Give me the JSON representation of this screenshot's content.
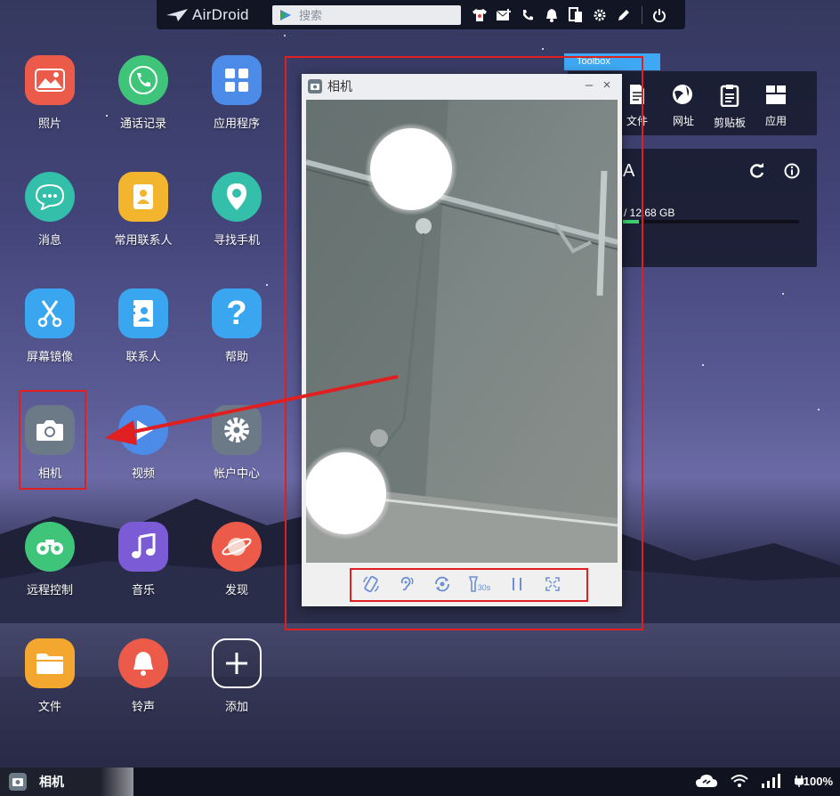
{
  "topbar": {
    "brand": "AirDroid",
    "search_placeholder": "搜索"
  },
  "apps": [
    {
      "label": "照片"
    },
    {
      "label": "通话记录"
    },
    {
      "label": "应用程序"
    },
    {
      "label": "消息"
    },
    {
      "label": "常用联系人"
    },
    {
      "label": "寻找手机"
    },
    {
      "label": "屏幕镜像"
    },
    {
      "label": "联系人"
    },
    {
      "label": "帮助"
    },
    {
      "label": "相机"
    },
    {
      "label": "视频"
    },
    {
      "label": "帐户中心"
    },
    {
      "label": "远程控制"
    },
    {
      "label": "音乐"
    },
    {
      "label": "发现"
    },
    {
      "label": "文件"
    },
    {
      "label": "铃声"
    },
    {
      "label": "添加"
    }
  ],
  "camera_window": {
    "title": "相机",
    "minimize": "–",
    "close": "×",
    "timer_label": "30s"
  },
  "toolbox": {
    "label": "Toolbox",
    "tools": [
      {
        "label": "文件"
      },
      {
        "label": "网址"
      },
      {
        "label": "剪贴板"
      },
      {
        "label": "应用"
      }
    ]
  },
  "device": {
    "name_partial": "A",
    "storage_text": "/ 12.68 GB",
    "storage_fill": 0.09
  },
  "taskbar": {
    "active_app": "相机",
    "battery": "100%"
  },
  "colors": {
    "highlight_red": "#e02020",
    "toolbox_blue": "#3fa8f4",
    "storage_green": "#3bd16f"
  }
}
